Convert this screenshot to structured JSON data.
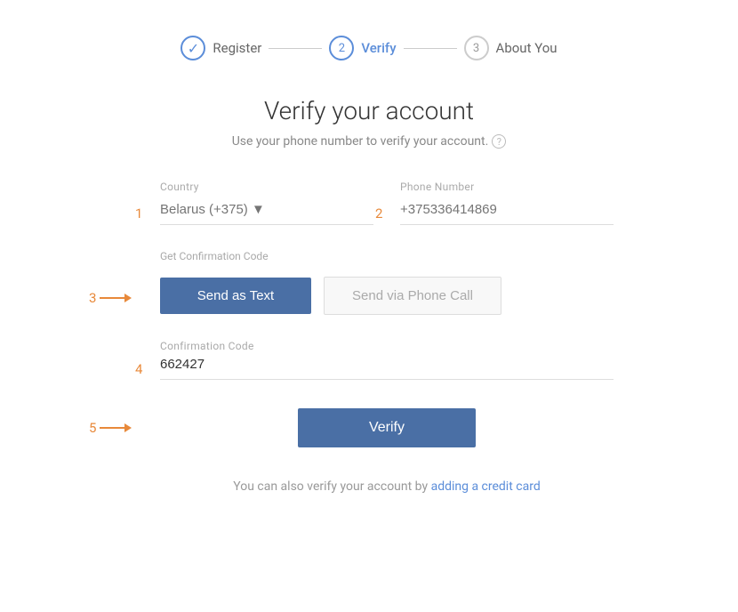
{
  "stepper": {
    "steps": [
      {
        "number": "✓",
        "label": "Register",
        "state": "completed"
      },
      {
        "number": "2",
        "label": "Verify",
        "state": "active"
      },
      {
        "number": "3",
        "label": "About You",
        "state": "inactive"
      }
    ],
    "line1": "—",
    "line2": "—"
  },
  "page": {
    "title": "Verify your account",
    "subtitle": "Use your phone number to verify your account."
  },
  "form": {
    "country_label": "Country",
    "country_placeholder": "Belarus (+375) ▼",
    "phone_label": "Phone Number",
    "phone_placeholder": "+375336414869",
    "confirmation_section_label": "Get Confirmation Code",
    "send_text_label": "Send as Text",
    "send_call_label": "Send via Phone Call",
    "confirmation_code_label": "Confirmation Code",
    "confirmation_code_value": "662427",
    "verify_label": "Verify",
    "footer_text": "You can also verify your account by ",
    "footer_link": "adding a credit card"
  },
  "step_numbers": {
    "s1": "1",
    "s2": "2",
    "s3": "3",
    "s4": "4",
    "s5": "5"
  },
  "colors": {
    "accent": "#e8893a",
    "primary_btn": "#4a6fa5",
    "step_active": "#5b8dd9"
  }
}
